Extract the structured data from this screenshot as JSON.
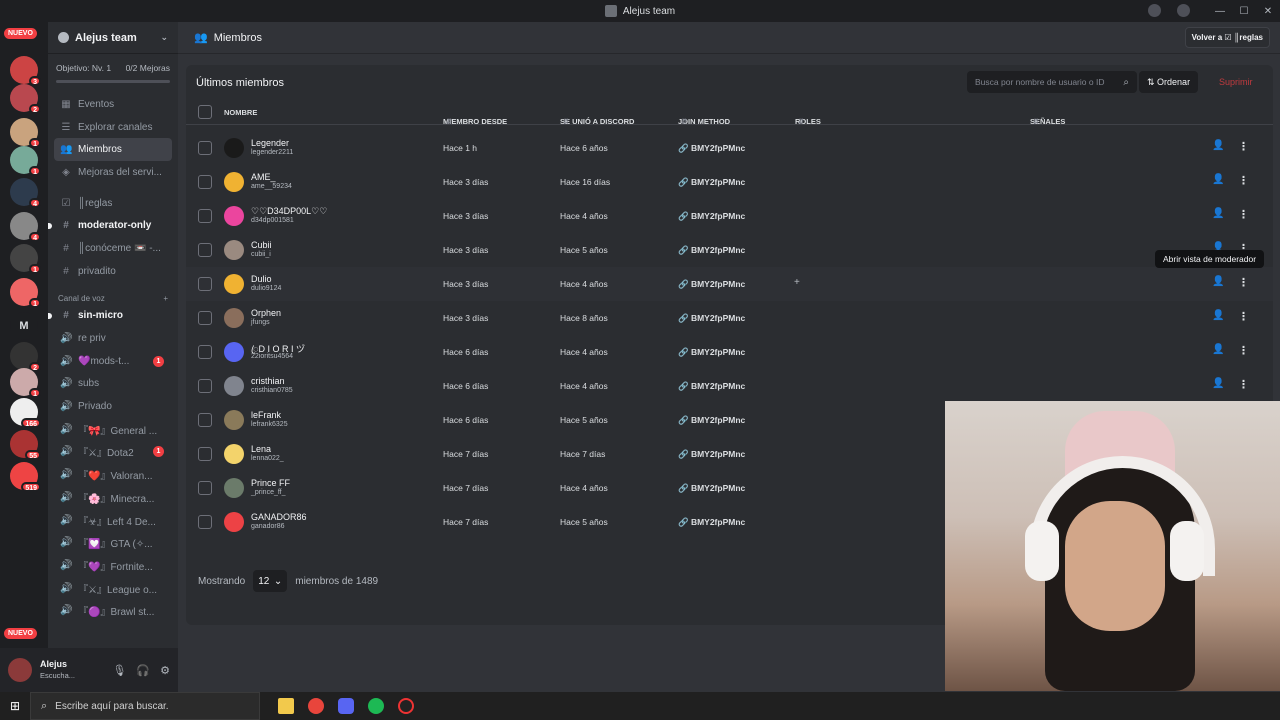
{
  "window": {
    "title": "Alejus team"
  },
  "guild_badges": [
    {
      "label": "NUEVO"
    },
    {
      "label": "3"
    },
    {
      "label": "2"
    },
    {
      "label": "1"
    },
    {
      "label": "1"
    },
    {
      "label": "4"
    },
    {
      "label": "4"
    },
    {
      "label": "1"
    },
    {
      "label": "1"
    },
    {
      "label": "M"
    },
    {
      "label": "2"
    },
    {
      "label": "1"
    },
    {
      "label": "166"
    },
    {
      "label": "55"
    },
    {
      "label": "519"
    },
    {
      "label": "NUEVO"
    }
  ],
  "sidebar": {
    "server_name": "Alejus team",
    "objective": "Objetivo: Nv. 1",
    "objective_progress": "0/2 Mejoras",
    "nav": [
      {
        "label": "Eventos"
      },
      {
        "label": "Explorar canales"
      },
      {
        "label": "Miembros"
      },
      {
        "label": "Mejoras del servi..."
      }
    ],
    "text_channels": [
      {
        "label": "║reglas"
      },
      {
        "label": "moderator-only"
      },
      {
        "label": "║conóceme 📼 -..."
      },
      {
        "label": "privadito"
      }
    ],
    "voice_category": "Canal de voz",
    "voice_channels": [
      {
        "label": "sin-micro"
      },
      {
        "label": "re priv"
      },
      {
        "label": "💜mods-t...",
        "badge": "1"
      },
      {
        "label": "subs"
      },
      {
        "label": "Privado"
      },
      {
        "label": "『🎀』General ...",
        "badge": ""
      },
      {
        "label": "『⚔』Dota2",
        "badge": "1"
      },
      {
        "label": "『❤️』Valoran..."
      },
      {
        "label": "『🌸』Minecra..."
      },
      {
        "label": "『☣』Left 4 De..."
      },
      {
        "label": "『💟』GTA (✧..."
      },
      {
        "label": "『💜』Fortnite..."
      },
      {
        "label": "『⚔』League o..."
      },
      {
        "label": "『🟣』Brawl st..."
      }
    ],
    "user": {
      "name": "Alejus",
      "status": "Escucha..."
    }
  },
  "header": {
    "title": "Miembros",
    "back_button": "Volver a ☑ ║reglas"
  },
  "members": {
    "section_title": "Últimos miembros",
    "search_placeholder": "Busca por nombre de usuario o ID",
    "sort_label": "Ordenar",
    "delete_label": "Suprimir",
    "columns": {
      "name": "NOMBRE",
      "member_since": "MIEMBRO DESDE",
      "joined_discord": "SE UNIÓ A DISCORD",
      "join_method": "JOIN METHOD",
      "roles": "ROLES",
      "signals": "SEÑALES"
    },
    "rows": [
      {
        "display": "Legender",
        "username": "legender2211",
        "since": "Hace 1 h",
        "discord": "Hace 6 años",
        "method": "🔗 BMY2fpPMnc",
        "avatar_color": "#1a1a1a"
      },
      {
        "display": "AME_",
        "username": "ame__59234",
        "since": "Hace 3 días",
        "discord": "Hace 16 días",
        "method": "🔗 BMY2fpPMnc",
        "avatar_color": "#f0b232"
      },
      {
        "display": "♡♡D34DP00L♡♡",
        "username": "d34dp001581",
        "since": "Hace 3 días",
        "discord": "Hace 4 años",
        "method": "🔗 BMY2fpPMnc",
        "avatar_color": "#eb459e"
      },
      {
        "display": "Cubii",
        "username": "cubii_i",
        "since": "Hace 3 días",
        "discord": "Hace 5 años",
        "method": "🔗 BMY2fpPMnc",
        "avatar_color": "#9a8a80"
      },
      {
        "display": "Dulio",
        "username": "dulio9124",
        "since": "Hace 3 días",
        "discord": "Hace 4 años",
        "method": "🔗 BMY2fpPMnc",
        "avatar_color": "#f0b232"
      },
      {
        "display": "Orphen",
        "username": "jfungs",
        "since": "Hace 3 días",
        "discord": "Hace 8 años",
        "method": "🔗 BMY2fpPMnc",
        "avatar_color": "#8a6e5c"
      },
      {
        "display": "ꦿD I O R I ヅ",
        "username": "22ioritsu4564",
        "since": "Hace 6 días",
        "discord": "Hace 4 años",
        "method": "🔗 BMY2fpPMnc",
        "avatar_color": "#5865f2"
      },
      {
        "display": "cristhian",
        "username": "cristhian0785",
        "since": "Hace 6 días",
        "discord": "Hace 4 años",
        "method": "🔗 BMY2fpPMnc",
        "avatar_color": "#80848e"
      },
      {
        "display": "leFrank",
        "username": "lefrank6325",
        "since": "Hace 6 días",
        "discord": "Hace 5 años",
        "method": "🔗 BMY2fpPMnc",
        "avatar_color": "#8a7a5a"
      },
      {
        "display": "Lena",
        "username": "lenna022_",
        "since": "Hace 7 días",
        "discord": "Hace 7 días",
        "method": "🔗 BMY2fpPMnc",
        "avatar_color": "#f3d36b"
      },
      {
        "display": "Prince FF",
        "username": "_prince_ff_",
        "since": "Hace 7 días",
        "discord": "Hace 4 años",
        "method": "🔗 BMY2fpPMnc",
        "avatar_color": "#6b7b6a"
      },
      {
        "display": "GANADOR86",
        "username": "ganador86",
        "since": "Hace 7 días",
        "discord": "Hace 5 años",
        "method": "🔗 BMY2fpPMnc",
        "avatar_color": "#ed4245"
      }
    ],
    "footer": {
      "showing": "Mostrando",
      "page_size": "12",
      "total": "miembros de 1489"
    },
    "tooltip": "Abrir vista de moderador"
  },
  "taskbar": {
    "search_placeholder": "Escribe aquí para buscar."
  }
}
